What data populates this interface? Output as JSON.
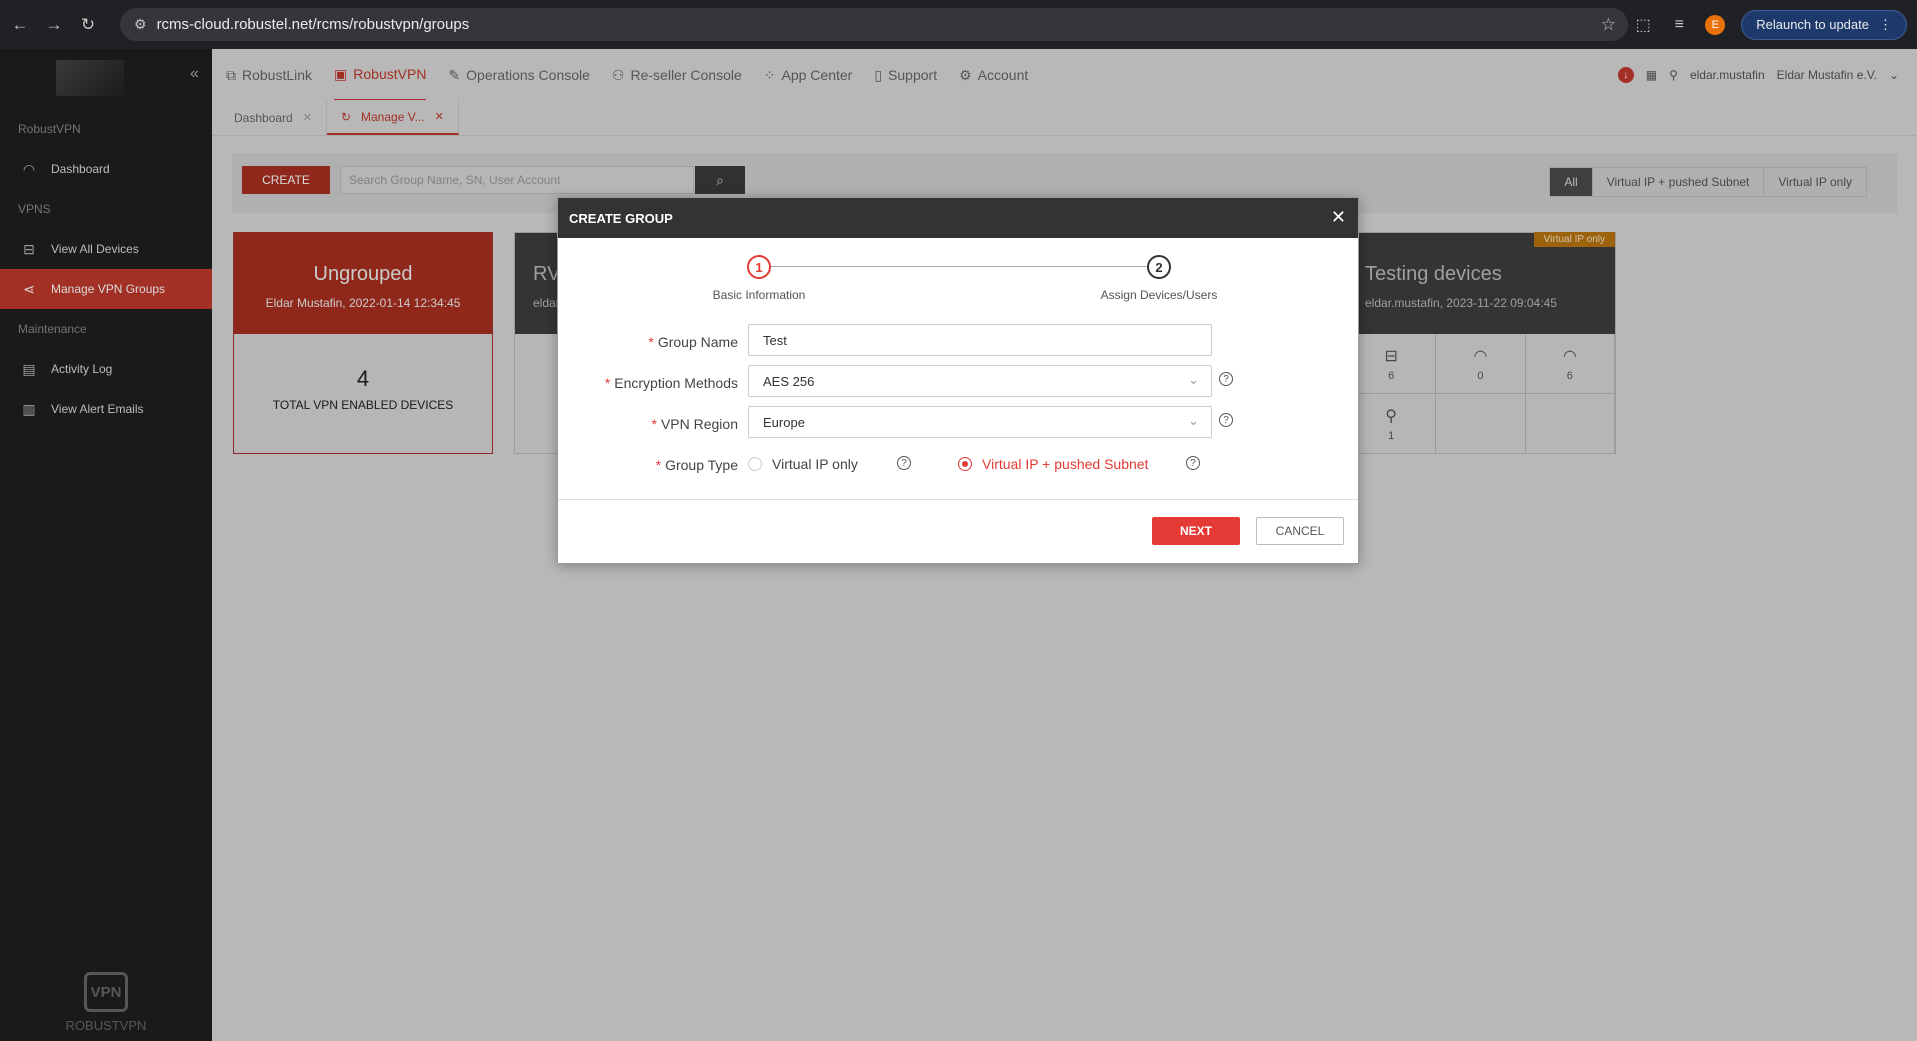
{
  "browser": {
    "url": "rcms-cloud.robustel.net/rcms/robustvpn/groups",
    "relaunch_label": "Relaunch to update",
    "profile_initial": "E"
  },
  "sidebar": {
    "section_robustvpn": "RobustVPN",
    "section_vpns": "VPNS",
    "section_maintenance": "Maintenance",
    "items": [
      {
        "label": "Dashboard",
        "icon": "gauge-icon"
      },
      {
        "label": "View All Devices",
        "icon": "router-icon"
      },
      {
        "label": "Manage VPN Groups",
        "icon": "share-icon"
      },
      {
        "label": "Activity Log",
        "icon": "log-icon"
      },
      {
        "label": "View Alert Emails",
        "icon": "mail-doc-icon"
      }
    ],
    "bottom_badge": "VPN",
    "bottom_label": "ROBUSTVPN"
  },
  "topnav": {
    "items": [
      {
        "label": "RobustLink"
      },
      {
        "label": "RobustVPN"
      },
      {
        "label": "Operations Console"
      },
      {
        "label": "Re-seller Console"
      },
      {
        "label": "App Center"
      },
      {
        "label": "Support"
      },
      {
        "label": "Account"
      }
    ],
    "username": "eldar.mustafin",
    "company": "Eldar Mustafin e.V."
  },
  "pagetabs": [
    {
      "label": "Dashboard"
    },
    {
      "label": "Manage V..."
    }
  ],
  "toolbar": {
    "create_label": "CREATE",
    "search_placeholder": "Search Group Name, SN, User Account",
    "filters": [
      "All",
      "Virtual IP + pushed Subnet",
      "Virtual IP only"
    ]
  },
  "cards": {
    "ungrouped": {
      "name": "Ungrouped",
      "meta": "Eldar Mustafin, 2022-01-14 12:34:45",
      "count": "4",
      "count_label": "TOTAL VPN ENABLED DEVICES"
    },
    "rv": {
      "name": "RV",
      "meta": "eldar."
    },
    "testing": {
      "tag": "Virtual IP only",
      "name": "Testing devices",
      "meta": "eldar.mustafin, 2023-11-22 09:04:45",
      "stats": [
        "6",
        "0",
        "6",
        "1"
      ]
    }
  },
  "modal": {
    "title": "CREATE GROUP",
    "steps": [
      {
        "num": "1",
        "label": "Basic Information"
      },
      {
        "num": "2",
        "label": "Assign Devices/Users"
      }
    ],
    "fields": {
      "group_name_label": "Group Name",
      "group_name_value": "Test",
      "encryption_label": "Encryption Methods",
      "encryption_value": "AES 256",
      "region_label": "VPN Region",
      "region_value": "Europe",
      "group_type_label": "Group Type",
      "group_type_options": [
        "Virtual IP only",
        "Virtual IP + pushed Subnet"
      ],
      "group_type_selected": "Virtual IP + pushed Subnet"
    },
    "next_label": "NEXT",
    "cancel_label": "CANCEL"
  }
}
